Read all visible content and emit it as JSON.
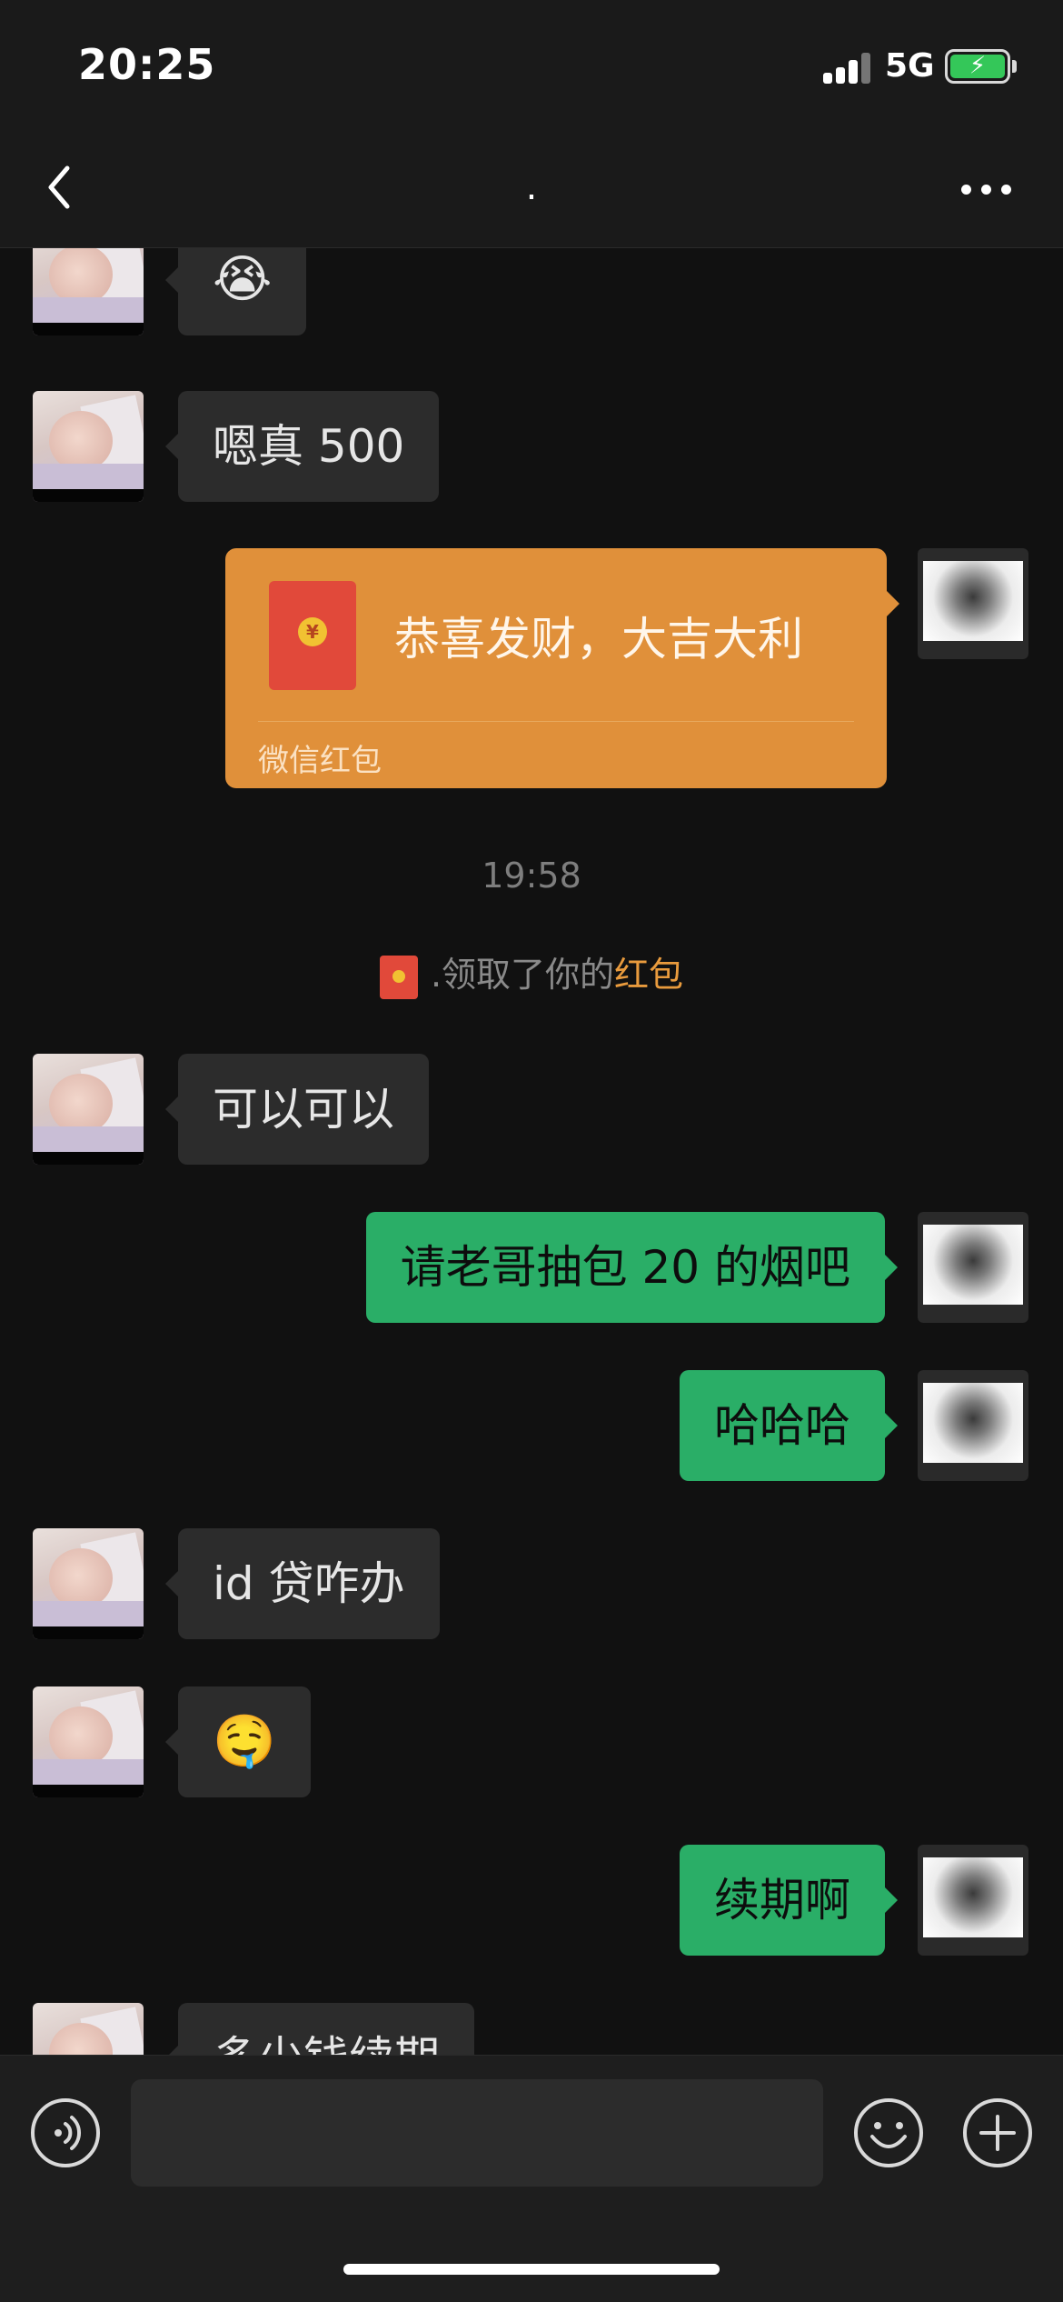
{
  "status_bar": {
    "time": "20:25",
    "network": "5G",
    "battery_bolt": "⚡"
  },
  "nav": {
    "title": "."
  },
  "messages": [
    {
      "side": "in",
      "kind": "emoji",
      "text": "😭"
    },
    {
      "side": "in",
      "kind": "text",
      "text": "嗯真 500"
    },
    {
      "side": "out",
      "kind": "text",
      "text": "请老哥抽包 20 的烟吧"
    },
    {
      "side": "out",
      "kind": "text",
      "text": "哈哈哈"
    },
    {
      "side": "in",
      "kind": "text",
      "text": "id 贷咋办"
    },
    {
      "side": "in",
      "kind": "emoji",
      "text": "🤤"
    },
    {
      "side": "out",
      "kind": "text",
      "text": "续期啊"
    },
    {
      "side": "in",
      "kind": "text",
      "text": "多少钱续期"
    },
    {
      "side": "in",
      "kind": "text",
      "text": "可以可以"
    }
  ],
  "red_packet": {
    "coin": "¥",
    "greeting": "恭喜发财，大吉大利",
    "footer": "微信红包"
  },
  "timestamp": "19:58",
  "notice": {
    "prefix": ".领取了你的",
    "link": "红包"
  },
  "colors": {
    "outgoing_bubble": "#2aae67",
    "incoming_bubble": "#2c2c2c",
    "red_packet": "#e0903a",
    "accent_link": "#e99b3d"
  },
  "icons": [
    "back-icon",
    "more-icon",
    "voice-icon",
    "emoji-face-icon",
    "plus-icon"
  ]
}
